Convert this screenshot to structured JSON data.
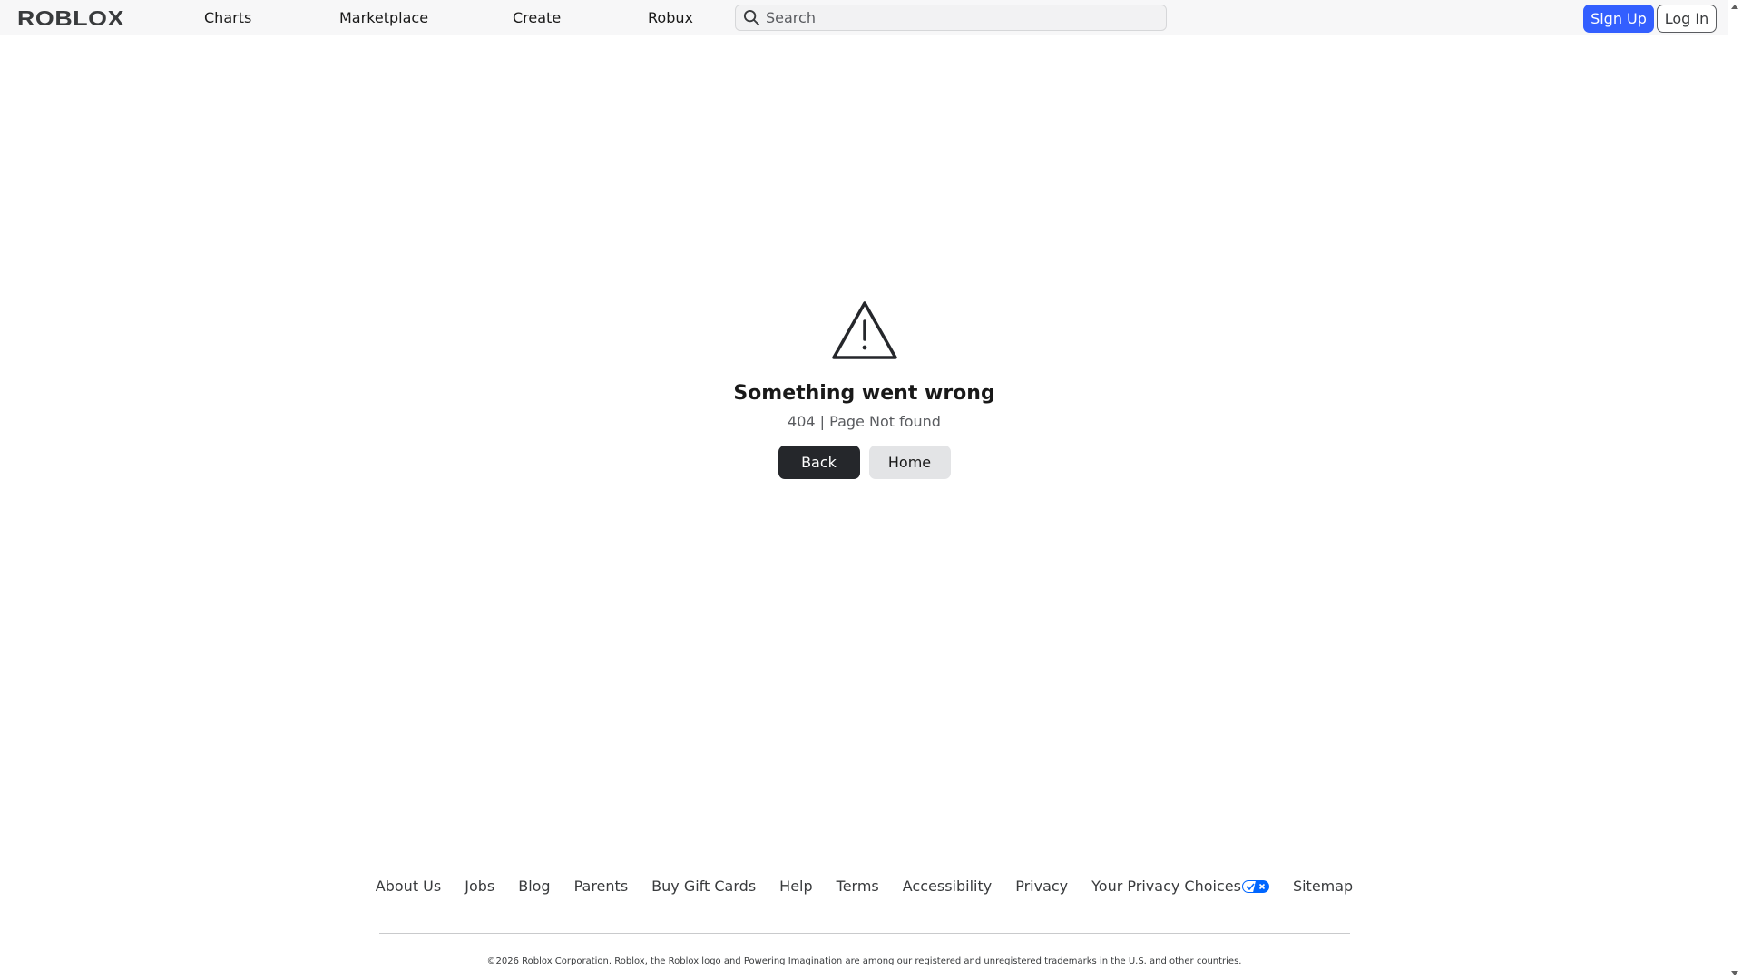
{
  "header": {
    "logo_text": "ROBLOX",
    "nav": [
      "Charts",
      "Marketplace",
      "Create",
      "Robux"
    ],
    "search_placeholder": "Search",
    "signup_label": "Sign Up",
    "login_label": "Log In"
  },
  "error": {
    "icon": "warning-triangle-icon",
    "title": "Something went wrong",
    "subtitle": "404 | Page Not found",
    "back_label": "Back",
    "home_label": "Home"
  },
  "footer": {
    "links": [
      "About Us",
      "Jobs",
      "Blog",
      "Parents",
      "Buy Gift Cards",
      "Help",
      "Terms",
      "Accessibility",
      "Privacy",
      "Your Privacy Choices",
      "Sitemap"
    ],
    "copyright": "©2026 Roblox Corporation. Roblox, the Roblox logo and Powering Imagination are among our registered and unregistered trademarks in the U.S. and other countries."
  },
  "colors": {
    "accent": "#335fff",
    "dark_button": "#25272b",
    "header_bg": "#f7f7f8"
  }
}
